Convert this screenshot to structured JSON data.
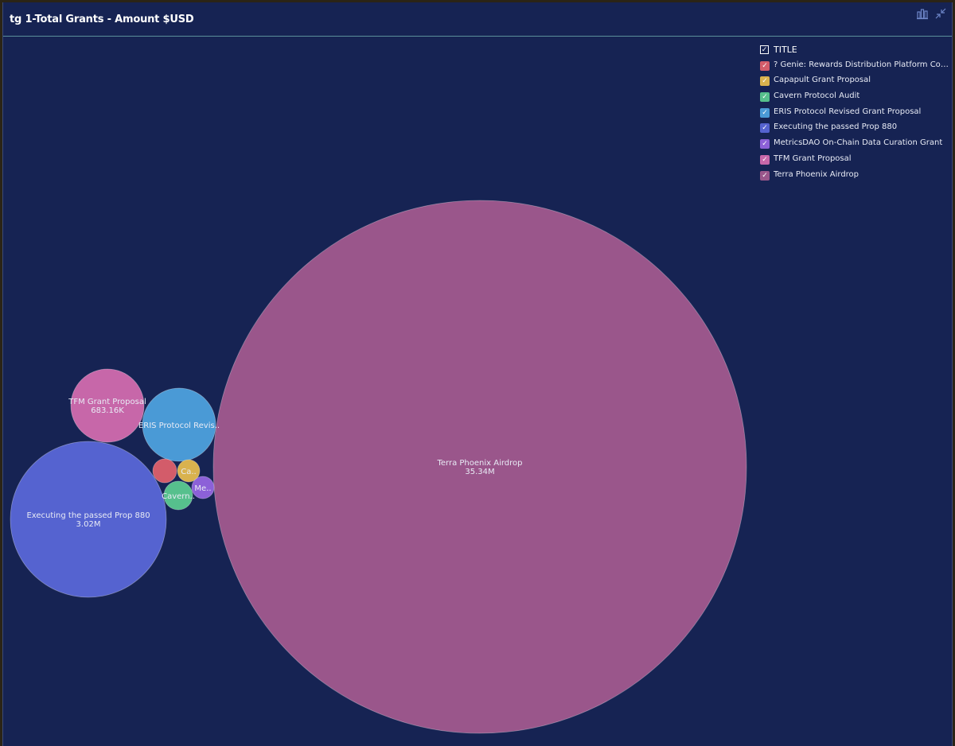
{
  "header": {
    "title": "tg 1-Total Grants - Amount $USD",
    "chart_type_icon": "bar-chart-icon",
    "collapse_icon": "collapse-arrows-icon"
  },
  "legend": {
    "title": "TITLE",
    "check_glyph": "✓"
  },
  "chart_data": {
    "type": "bubble",
    "title": "tg 1-Total Grants - Amount $USD",
    "legend_title": "TITLE",
    "legend_position": "top-right",
    "series": [
      {
        "name": "? Genie: Rewards Distribution Platform Com...",
        "color": "#d35c6a",
        "label": "",
        "value_label": ""
      },
      {
        "name": "Capapult Grant Proposal",
        "color": "#d9b24e",
        "label": "Ca..",
        "value_label": ""
      },
      {
        "name": "Cavern Protocol Audit",
        "color": "#56c08d",
        "label": "Cavern..",
        "value_label": ""
      },
      {
        "name": "ERIS Protocol Revised Grant Proposal",
        "color": "#4a9ad6",
        "label": "ERIS Protocol Revis..",
        "value_label": ""
      },
      {
        "name": "Executing the passed Prop 880",
        "color": "#5563d0",
        "label": "Executing the passed Prop 880",
        "value_label": "3.02M",
        "value": 3020000
      },
      {
        "name": "MetricsDAO On-Chain Data Curation Grant",
        "color": "#8c61d8",
        "label": "Me..",
        "value_label": ""
      },
      {
        "name": "TFM Grant Proposal",
        "color": "#c767a9",
        "label": "TFM Grant Proposal",
        "value_label": "683.16K",
        "value": 683160
      },
      {
        "name": "Terra Phoenix Airdrop",
        "color": "#9a568b",
        "label": "Terra Phoenix Airdrop",
        "value_label": "35.34M",
        "value": 35340000
      }
    ]
  }
}
